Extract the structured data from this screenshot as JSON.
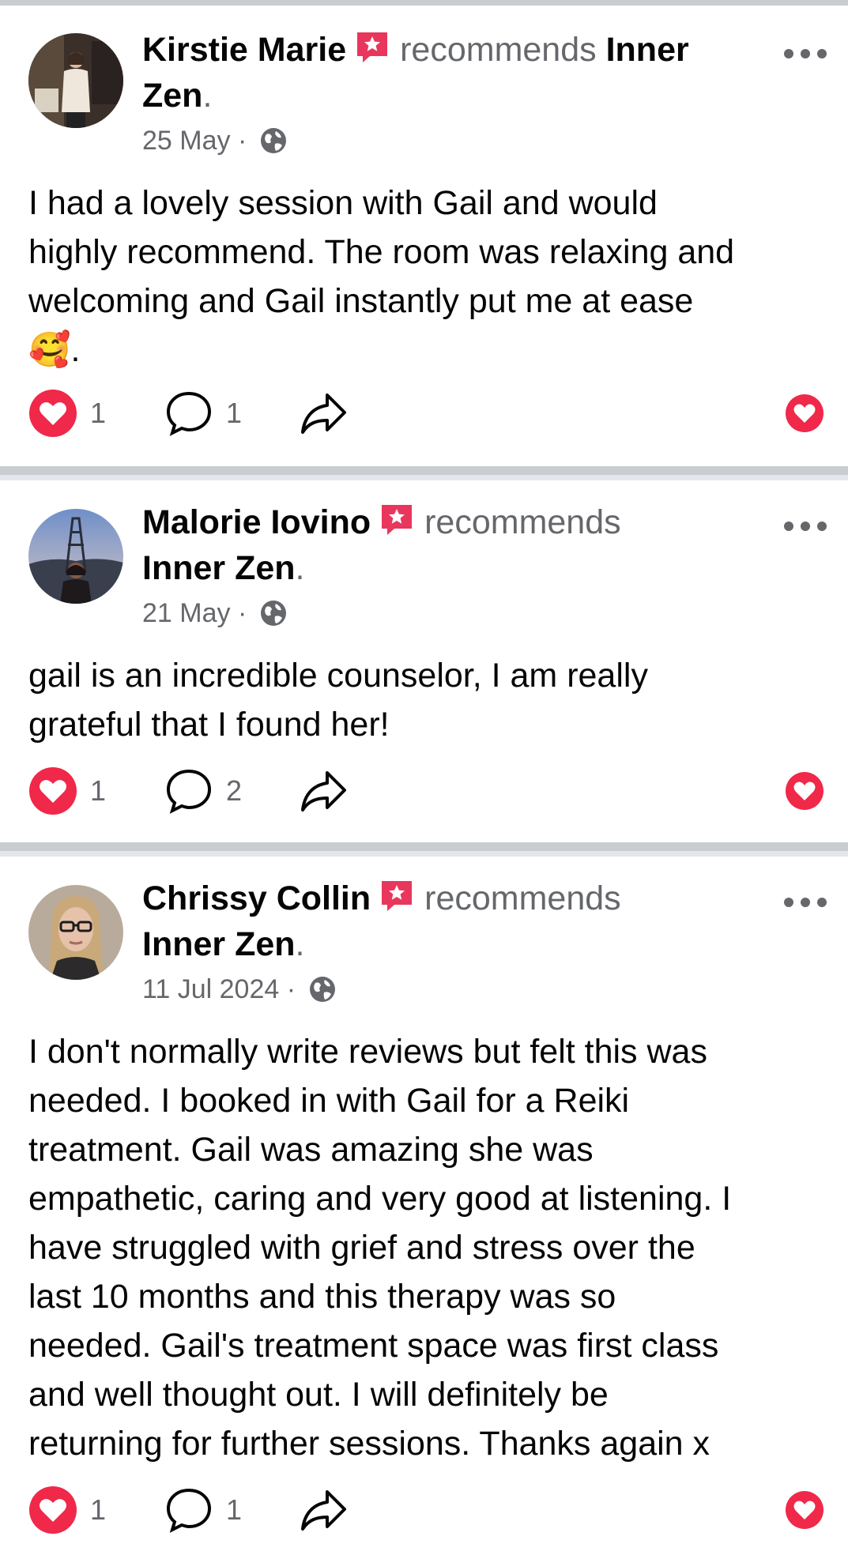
{
  "colors": {
    "text": "#050505",
    "secondary": "#65676b",
    "reaction": "#f02849",
    "badge": "#e8365c",
    "divider": "#c9ccd1"
  },
  "posts": [
    {
      "author": "Kirstie Marie",
      "verb": "recommends",
      "page_part1": "Inner",
      "page_part2": "Zen",
      "date": "25 May",
      "separator": "·",
      "text_lines": [
        "I had a lovely session with Gail and would",
        "highly recommend. The room was relaxing and",
        "welcoming and Gail instantly put me at ease",
        "🥰."
      ],
      "reactions": "1",
      "comments": "1"
    },
    {
      "author": "Malorie Iovino",
      "verb": "recommends",
      "page": "Inner Zen",
      "date": "21 May",
      "separator": "·",
      "text_lines": [
        "gail is an incredible counselor, I am really",
        "grateful that I found her!"
      ],
      "reactions": "1",
      "comments": "2"
    },
    {
      "author": "Chrissy Collin",
      "verb": "recommends",
      "page": "Inner Zen",
      "date": "11 Jul 2024",
      "separator": "·",
      "text_lines": [
        "I don't normally write reviews but felt this was",
        "needed. I booked in with Gail for a Reiki",
        "treatment. Gail was amazing she was",
        "empathetic, caring and very good at listening. I",
        "have struggled with grief and stress over the",
        "last 10 months and this therapy was so",
        "needed. Gail's treatment space was first class",
        "and well thought out. I will definitely be",
        "returning for further sessions. Thanks again x"
      ],
      "reactions": "1",
      "comments": "1"
    }
  ],
  "icons": {
    "badge": "recommendation-badge-icon",
    "globe": "globe-public-icon",
    "more": "more-options-icon",
    "like": "heart-reaction-icon",
    "comment": "comment-icon",
    "share": "share-icon"
  }
}
